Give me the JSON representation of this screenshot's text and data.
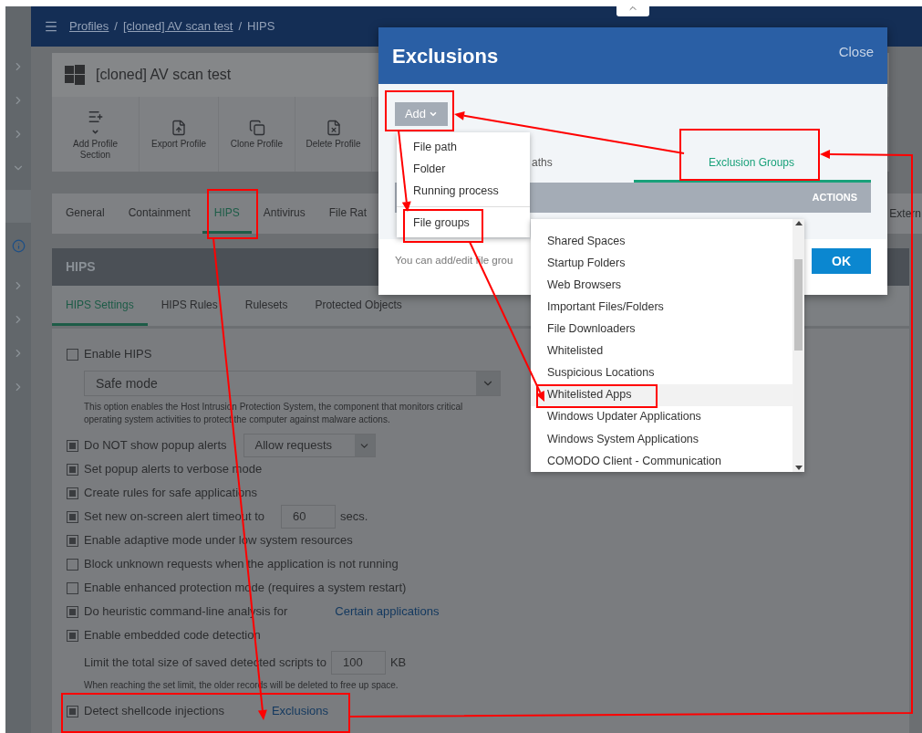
{
  "breadcrumb": {
    "links": [
      "Profiles",
      "[cloned] AV scan test"
    ],
    "separator": "/",
    "current": "HIPS"
  },
  "profile": {
    "title": "[cloned] AV scan test"
  },
  "toolbar": [
    {
      "kind": "add",
      "label": "Add Profile Section"
    },
    {
      "kind": "export",
      "label": "Export Profile"
    },
    {
      "kind": "clone",
      "label": "Clone Profile"
    },
    {
      "kind": "delete",
      "label": "Delete Profile"
    }
  ],
  "tabs": [
    {
      "label": "General",
      "selected": false
    },
    {
      "label": "Containment",
      "selected": false
    },
    {
      "label": "HIPS",
      "selected": true
    },
    {
      "label": "Antivirus",
      "selected": false
    },
    {
      "label": "File Rat",
      "selected": false
    }
  ],
  "tab_right": "Extern",
  "section": {
    "title": "HIPS"
  },
  "subtabs": [
    {
      "label": "HIPS Settings",
      "selected": true
    },
    {
      "label": "HIPS Rules",
      "selected": false
    },
    {
      "label": "Rulesets",
      "selected": false
    },
    {
      "label": "Protected Objects",
      "selected": false
    }
  ],
  "settings": [
    {
      "kind": "checkbox",
      "label": "Enable HIPS",
      "checked": false
    },
    {
      "kind": "select",
      "value": "Safe mode"
    },
    {
      "kind": "note",
      "text": "This option enables the Host Intrusion Protection System, the component that monitors critical operating system activities to protect the computer against malware actions."
    },
    {
      "kind": "checkbox",
      "label": "Do NOT show popup alerts",
      "checked": true,
      "select": "Allow requests"
    },
    {
      "kind": "checkbox",
      "label": "Set popup alerts to verbose mode",
      "checked": true
    },
    {
      "kind": "checkbox",
      "label": "Create rules for safe applications",
      "checked": true
    },
    {
      "kind": "checkbox",
      "label": "Set new on-screen alert timeout to",
      "checked": true,
      "input": "60",
      "suffix": "secs."
    },
    {
      "kind": "checkbox",
      "label": "Enable adaptive mode under low system resources",
      "checked": true
    },
    {
      "kind": "checkbox",
      "label": "Block unknown requests when the application is not running",
      "checked": false
    },
    {
      "kind": "checkbox",
      "label": "Enable enhanced protection mode (requires a system restart)",
      "checked": false
    },
    {
      "kind": "checkbox",
      "label": "Do heuristic command-line analysis for",
      "checked": true,
      "link": "Certain applications"
    },
    {
      "kind": "checkbox",
      "label": "Enable embedded code detection",
      "checked": true
    },
    {
      "kind": "input",
      "label": "Limit the total size of saved detected scripts to",
      "input": "100",
      "suffix": "KB"
    },
    {
      "kind": "note",
      "text": "When reaching the set limit, the older records will be deleted to free up space."
    },
    {
      "kind": "checkbox",
      "label": "Detect shellcode injections",
      "checked": true,
      "link": "Exclusions"
    }
  ],
  "dialog": {
    "title": "Exclusions",
    "close": "Close",
    "add": "Add",
    "tabs": [
      {
        "label": "aths",
        "selected": false
      },
      {
        "label": "Exclusion Groups",
        "selected": true
      }
    ],
    "column": "ACTIONS",
    "hint": "You can add/edit file grou",
    "ok": "OK"
  },
  "add_menu": [
    {
      "label": "File path",
      "divider": false
    },
    {
      "label": "Folder",
      "divider": false
    },
    {
      "label": "Running process",
      "divider": false
    },
    {
      "label": "File groups",
      "divider": true
    }
  ],
  "file_groups": [
    {
      "label": "Shared Spaces",
      "selected": false
    },
    {
      "label": "Startup Folders",
      "selected": false
    },
    {
      "label": "Web Browsers",
      "selected": false
    },
    {
      "label": "Important Files/Folders",
      "selected": false
    },
    {
      "label": "File Downloaders",
      "selected": false
    },
    {
      "label": "Whitelisted",
      "selected": false
    },
    {
      "label": "Suspicious Locations",
      "selected": false
    },
    {
      "label": "Whitelisted Apps",
      "selected": true
    },
    {
      "label": "Windows Updater Applications",
      "selected": false
    },
    {
      "label": "Windows System Applications",
      "selected": false
    },
    {
      "label": "COMODO Client - Communication",
      "selected": false
    }
  ]
}
